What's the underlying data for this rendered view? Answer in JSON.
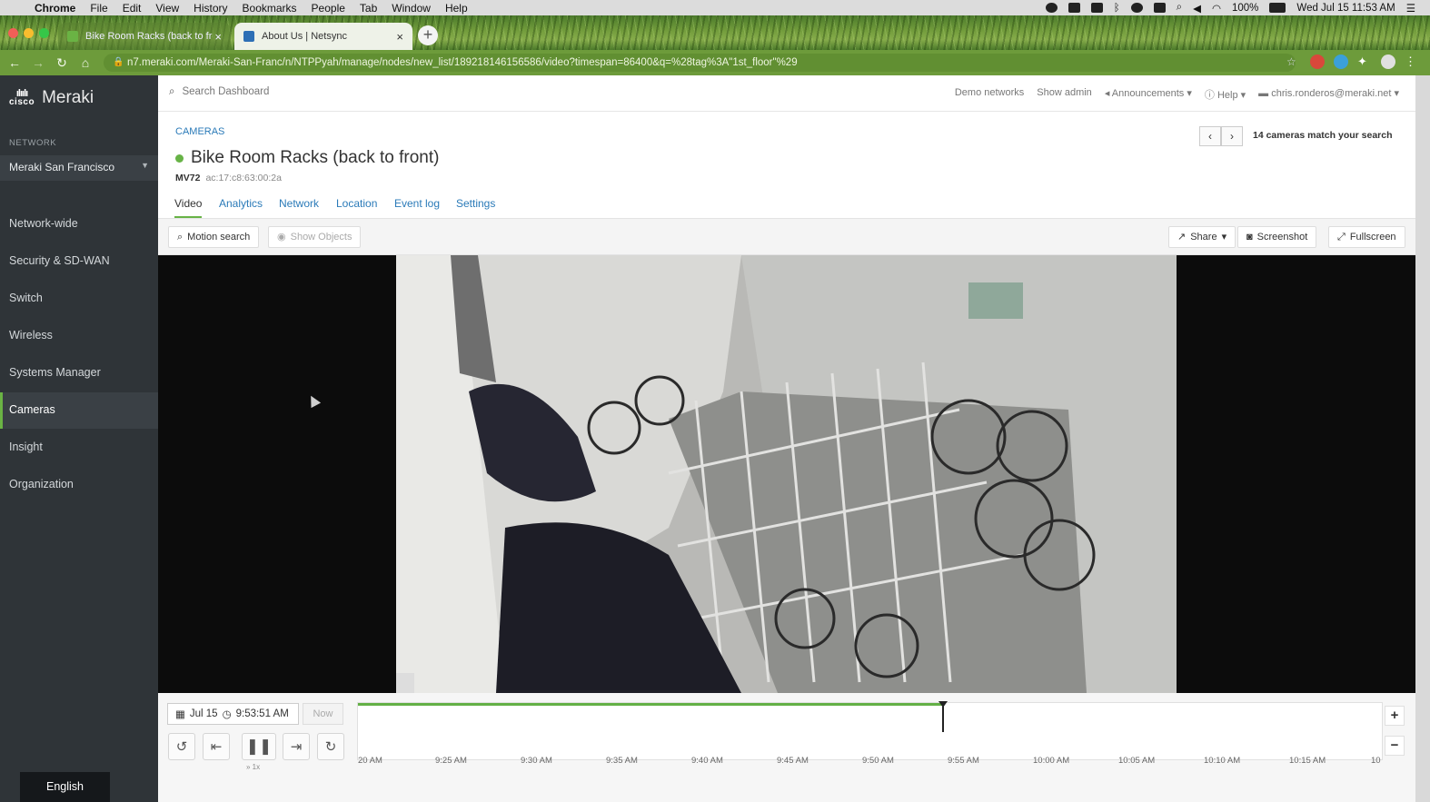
{
  "os_menu": {
    "app": "Chrome",
    "items": [
      "File",
      "Edit",
      "View",
      "History",
      "Bookmarks",
      "People",
      "Tab",
      "Window",
      "Help"
    ],
    "battery": "100%",
    "clock": "Wed Jul 15  11:53 AM"
  },
  "browser": {
    "tabs": [
      {
        "title": "Bike Room Racks (back to fron",
        "active": false
      },
      {
        "title": "About Us | Netsync",
        "active": true
      }
    ],
    "url": "n7.meraki.com/Meraki-San-Franc/n/NTPPyah/manage/nodes/new_list/189218146156586/video?timespan=86400&q=%28tag%3A\"1st_floor\"%29"
  },
  "sidebar": {
    "brand": "Meraki",
    "cisco": "cisco",
    "network_label": "NETWORK",
    "network": "Meraki San Francisco",
    "items": [
      {
        "label": "Network-wide"
      },
      {
        "label": "Security & SD-WAN"
      },
      {
        "label": "Switch"
      },
      {
        "label": "Wireless"
      },
      {
        "label": "Systems Manager"
      },
      {
        "label": "Cameras",
        "active": true
      },
      {
        "label": "Insight"
      },
      {
        "label": "Organization"
      }
    ],
    "language": "English"
  },
  "topbar": {
    "search_placeholder": "Search Dashboard",
    "demo": "Demo networks",
    "show_admin": "Show admin",
    "announcements": "Announcements",
    "help": "Help",
    "user": "chris.ronderos@meraki.net"
  },
  "camera": {
    "breadcrumb": "CAMERAS",
    "title": "Bike Room Racks (back to front)",
    "model": "MV72",
    "mac": "ac:17:c8:63:00:2a",
    "match_text": "14 cameras match your search",
    "status_color": "#67b346"
  },
  "tabs": [
    "Video",
    "Analytics",
    "Network",
    "Location",
    "Event log",
    "Settings"
  ],
  "video_bar": {
    "motion_search": "Motion search",
    "show_objects": "Show Objects",
    "share": "Share",
    "screenshot": "Screenshot",
    "fullscreen": "Fullscreen"
  },
  "timeline": {
    "date": "Jul 15",
    "time": "9:53:51 AM",
    "now": "Now",
    "speed": "» 1x",
    "ticks": [
      "20 AM",
      "9:25 AM",
      "9:30 AM",
      "9:35 AM",
      "9:40 AM",
      "9:45 AM",
      "9:50 AM",
      "9:55 AM",
      "10:00 AM",
      "10:05 AM",
      "10:10 AM",
      "10:15 AM",
      "10"
    ],
    "played_fraction": 0.57
  },
  "colors": {
    "accent": "#67b346",
    "link": "#2a7ab8",
    "sidebar": "#2f3438"
  }
}
